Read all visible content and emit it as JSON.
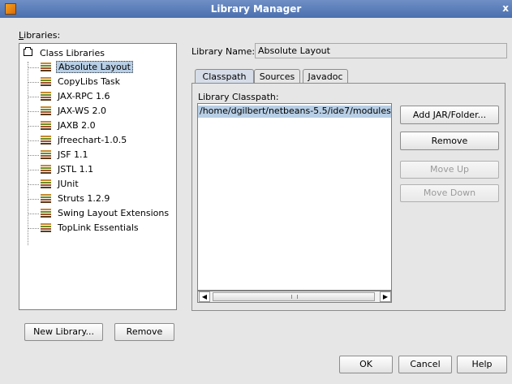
{
  "window": {
    "title": "Library Manager",
    "close_glyph": "x",
    "icon": "app-icon"
  },
  "libraries_label": "Libraries:",
  "tree": {
    "root": "Class Libraries",
    "items": [
      {
        "label": "Absolute Layout",
        "selected": true
      },
      {
        "label": "CopyLibs Task"
      },
      {
        "label": "JAX-RPC 1.6"
      },
      {
        "label": "JAX-WS 2.0"
      },
      {
        "label": "JAXB 2.0"
      },
      {
        "label": "jfreechart-1.0.5"
      },
      {
        "label": "JSF 1.1"
      },
      {
        "label": "JSTL 1.1"
      },
      {
        "label": "JUnit"
      },
      {
        "label": "Struts 1.2.9"
      },
      {
        "label": "Swing Layout Extensions"
      },
      {
        "label": "TopLink Essentials"
      }
    ]
  },
  "library_name": {
    "label": "Library Name:",
    "value": "Absolute Layout"
  },
  "tabs": [
    {
      "label": "Classpath",
      "active": true
    },
    {
      "label": "Sources"
    },
    {
      "label": "Javadoc"
    }
  ],
  "classpath": {
    "label": "Library Classpath:",
    "entries": [
      "/home/dgilbert/netbeans-5.5/ide7/modules"
    ]
  },
  "side_buttons": {
    "add": "Add JAR/Folder...",
    "remove": "Remove",
    "move_up": "Move Up",
    "move_down": "Move Down"
  },
  "bottom_left_buttons": {
    "new_library": "New Library...",
    "remove": "Remove"
  },
  "dialog_buttons": {
    "ok": "OK",
    "cancel": "Cancel",
    "help": "Help"
  },
  "scrollbar": {
    "left_arrow": "◀",
    "right_arrow": "▶"
  }
}
